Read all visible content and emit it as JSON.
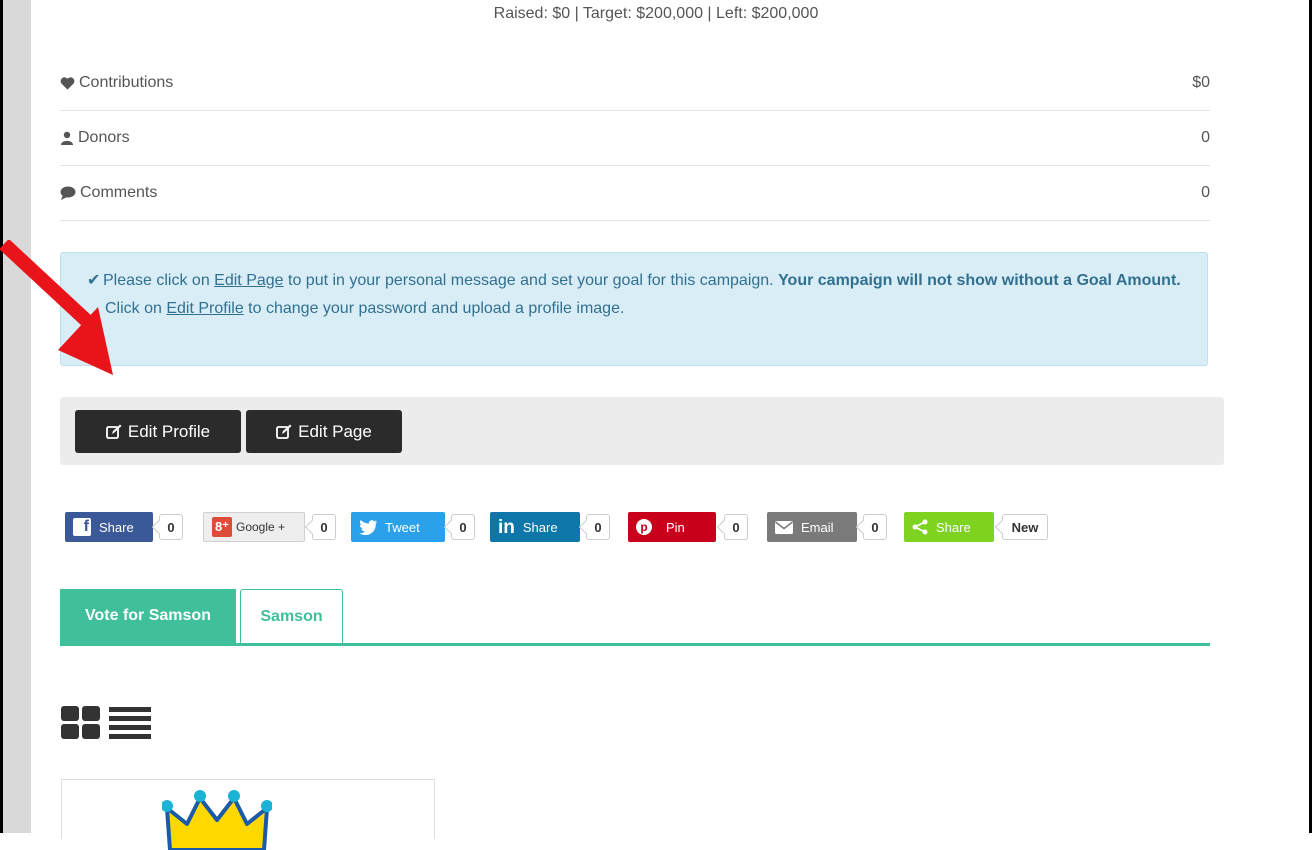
{
  "summary": {
    "raised_line": "Raised: $0 | Target: $200,000 | Left: $200,000"
  },
  "stats": [
    {
      "icon": "heart-icon",
      "label": "Contributions",
      "value": "$0"
    },
    {
      "icon": "user-icon",
      "label": "Donors",
      "value": "0"
    },
    {
      "icon": "comment-icon",
      "label": "Comments",
      "value": "0"
    }
  ],
  "alert": {
    "line1_pre": "Please click on ",
    "line1_link": "Edit Page",
    "line1_mid": " to put in your personal message and set your goal for this campaign. ",
    "line1_bold": "Your campaign will not show without a Goal Amount.",
    "line2_pre": "Click on ",
    "line2_link": "Edit Profile",
    "line2_post": " to change your password and upload a profile image."
  },
  "buttons": {
    "edit_profile": "Edit Profile",
    "edit_page": "Edit Page"
  },
  "share": [
    {
      "label": "Share",
      "icon": "facebook-icon",
      "color": "#3b5998",
      "count": "0"
    },
    {
      "label": "Google +",
      "icon": "google-plus-icon",
      "color": "#eeeeee",
      "count": "0"
    },
    {
      "label": "Tweet",
      "icon": "twitter-icon",
      "color": "#2ba1ec",
      "count": "0"
    },
    {
      "label": "Share",
      "icon": "linkedin-icon",
      "color": "#0e76a8",
      "count": "0"
    },
    {
      "label": "Pin",
      "icon": "pinterest-icon",
      "color": "#c8001c",
      "count": "0"
    },
    {
      "label": "Email",
      "icon": "email-icon",
      "color": "#7a7a7a",
      "count": "0"
    },
    {
      "label": "Share",
      "icon": "share-icon",
      "color": "#7ed321",
      "count": "New"
    }
  ],
  "tabs": [
    {
      "label": "Vote for Samson",
      "active": true
    },
    {
      "label": "Samson",
      "active": false
    }
  ],
  "colors": {
    "accent": "#3fbf9a",
    "alert_bg": "#d9edf7",
    "alert_text": "#31708f",
    "arrow": "#e8141a"
  }
}
